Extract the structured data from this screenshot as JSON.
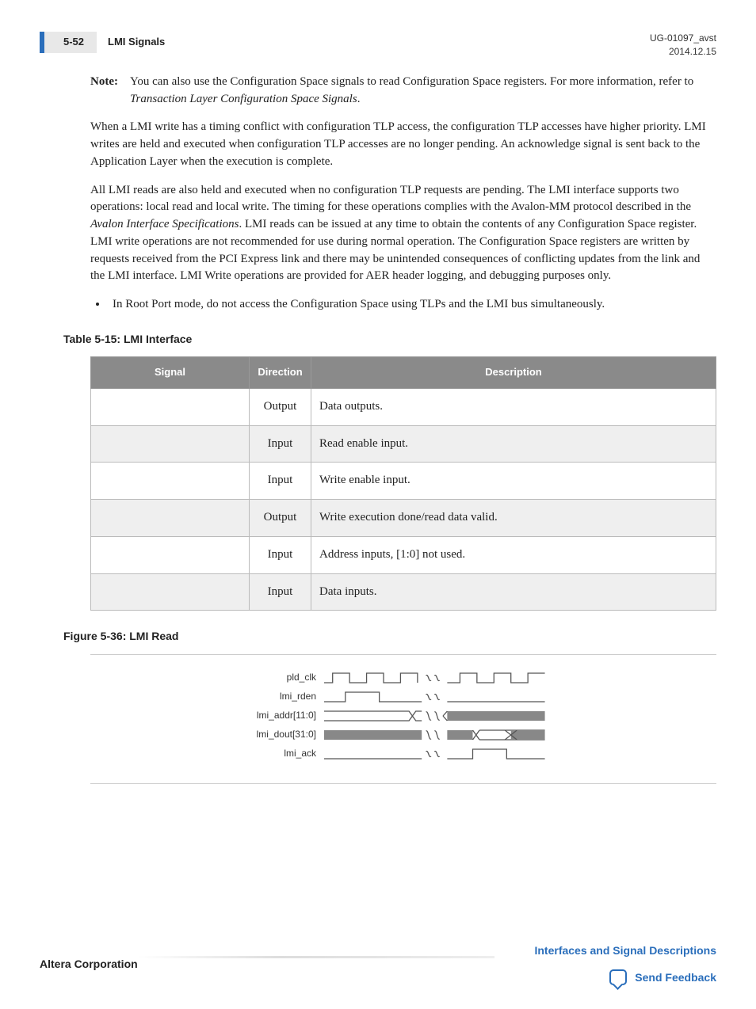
{
  "header": {
    "page_number": "5-52",
    "section": "LMI Signals",
    "doc_id": "UG-01097_avst",
    "date": "2014.12.15"
  },
  "note": {
    "label": "Note:",
    "text_before": "You can also use the Configuration Space signals to read Configuration Space registers. For more information, refer to ",
    "text_italic": "Transaction Layer Configuration Space Signals",
    "text_after": "."
  },
  "para1": "When a LMI write has a timing conflict with configuration TLP access, the configuration TLP accesses have higher priority. LMI writes are held and executed when configuration TLP accesses are no longer pending. An acknowledge signal is sent back to the Application Layer when the execution is complete.",
  "para2_a": "All LMI reads are also held and executed when no configuration TLP requests are pending. The LMI interface supports two operations: local read and local write. The timing for these operations complies with the Avalon-MM protocol described in the ",
  "para2_italic": "Avalon Interface Specifications",
  "para2_b": ". LMI reads can be issued at any time to obtain the contents of any Configuration Space register. LMI write operations are not recommended for use during normal operation. The Configuration Space registers are written by requests received from the PCI Express link and there may be unintended consequences of conflicting updates from the link and the LMI interface. LMI Write operations are provided for AER header logging, and debugging purposes only.",
  "bullet1": "In Root Port mode, do not access the Configuration Space using TLPs and the LMI bus simultaneously.",
  "table": {
    "title": "Table 5-15: LMI Interface",
    "headers": {
      "signal": "Signal",
      "direction": "Direction",
      "description": "Description"
    },
    "rows": [
      {
        "signal": "",
        "direction": "Output",
        "description": "Data outputs."
      },
      {
        "signal": "",
        "direction": "Input",
        "description": "Read enable input."
      },
      {
        "signal": "",
        "direction": "Input",
        "description": "Write enable input."
      },
      {
        "signal": "",
        "direction": "Output",
        "description": "Write execution done/read data valid."
      },
      {
        "signal": "",
        "direction": "Input",
        "description": "Address inputs, [1:0] not used."
      },
      {
        "signal": "",
        "direction": "Input",
        "description": "Data inputs."
      }
    ]
  },
  "figure": {
    "title": "Figure 5-36: LMI Read",
    "signals": [
      "pld_clk",
      "lmi_rden",
      "lmi_addr[11:0]",
      "lmi_dout[31:0]",
      "lmi_ack"
    ]
  },
  "footer": {
    "left": "Altera Corporation",
    "right_link": "Interfaces and Signal Descriptions",
    "feedback": "Send Feedback"
  }
}
